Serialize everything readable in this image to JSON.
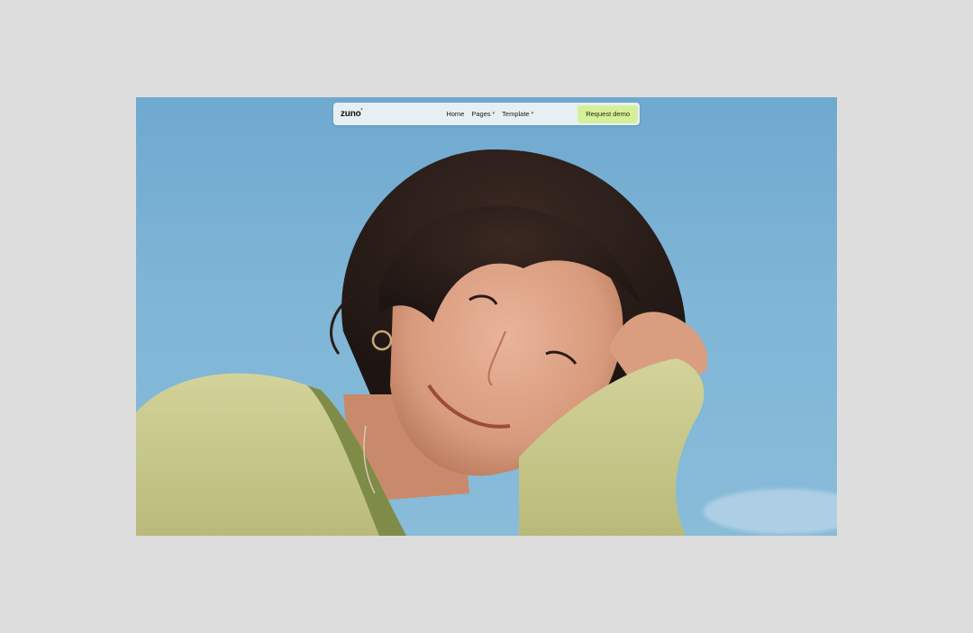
{
  "nav": {
    "logo": "zuno",
    "logo_mark": "°",
    "links": [
      {
        "label": "Home",
        "dropdown": false
      },
      {
        "label": "Pages",
        "dropdown": true
      },
      {
        "label": "Template",
        "dropdown": true
      }
    ],
    "cta_label": "Request demo"
  },
  "colors": {
    "page_bg": "#dddddd",
    "sky": "#7fb5d6",
    "cta_bg": "#d6f09a",
    "sweater": "#c8c98a"
  },
  "icons": {
    "dropdown": "chevron-down-icon"
  }
}
